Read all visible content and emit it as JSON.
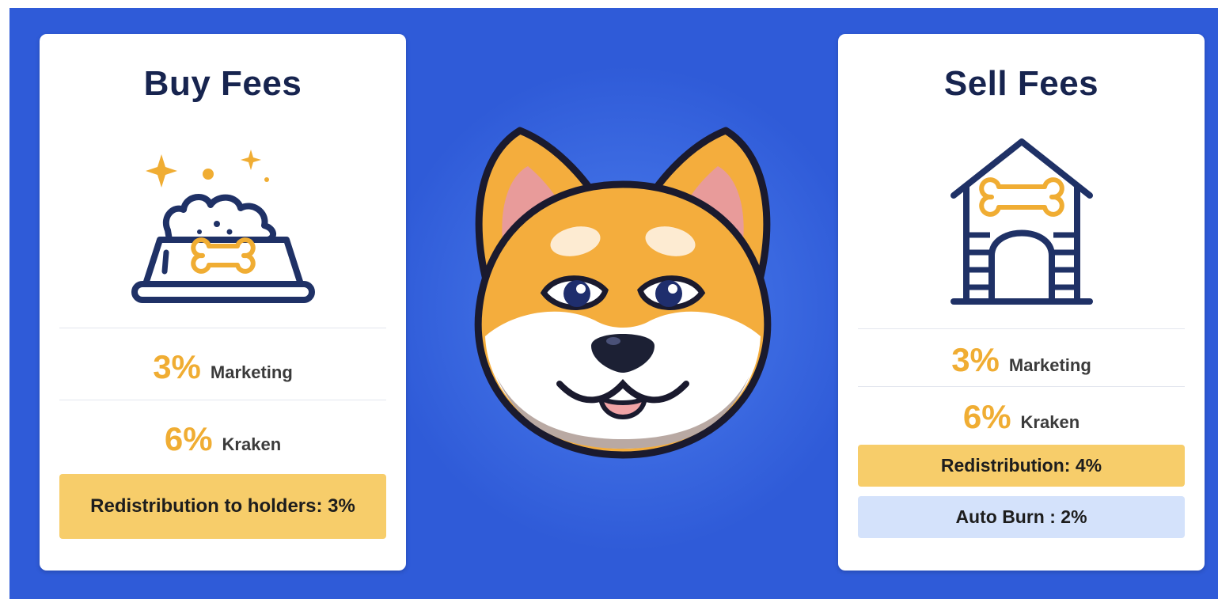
{
  "colors": {
    "background": "#2f5bd8",
    "card": "#ffffff",
    "title": "#17244f",
    "accent": "#f0ad33",
    "pill_yellow": "#f7cd6a",
    "pill_blue": "#d4e2fb",
    "icon_stroke": "#1f3166"
  },
  "buy": {
    "title": "Buy Fees",
    "icon": "dog-food-bowl-icon",
    "fees": [
      {
        "percent": "3%",
        "label": "Marketing"
      },
      {
        "percent": "6%",
        "label": "Kraken"
      }
    ],
    "highlight": "Redistribution to holders: 3%"
  },
  "mascot": {
    "icon": "shiba-inu-mascot"
  },
  "sell": {
    "title": "Sell Fees",
    "icon": "dog-house-icon",
    "fees": [
      {
        "percent": "3%",
        "label": "Marketing"
      },
      {
        "percent": "6%",
        "label": "Kraken"
      }
    ],
    "highlight": "Redistribution: 4%",
    "burn": "Auto Burn : 2%"
  }
}
